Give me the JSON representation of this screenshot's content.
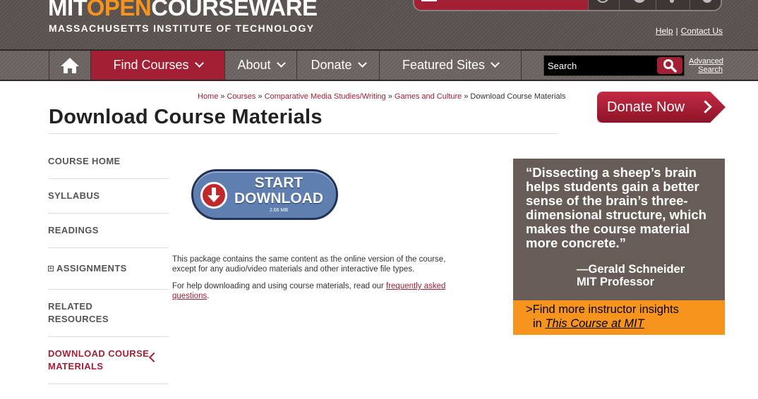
{
  "brand": {
    "logo_mit": "MIT",
    "logo_open": "OPEN",
    "logo_cw": "COURSEWARE",
    "logo_sub": "MASSACHUSETTS INSTITUTE OF TECHNOLOGY"
  },
  "util_links": {
    "help": "Help",
    "pipe": "|",
    "contact": "Contact Us"
  },
  "nav": {
    "home_icon": "home-icon",
    "find_courses": "Find Courses",
    "about": "About",
    "donate": "Donate",
    "featured_sites": "Featured Sites",
    "search_placeholder": "Search",
    "advanced_search": "Advanced\nSearch"
  },
  "breadcrumb": {
    "items": [
      "Home",
      "Courses",
      "Comparative Media Studies/Writing",
      "Games and Culture"
    ],
    "current": "Download Course Materials",
    "separator": "»"
  },
  "page_title": "Download Course Materials",
  "donate_now": "Donate Now",
  "sidebar": {
    "items": [
      {
        "label": "COURSE HOME"
      },
      {
        "label": "SYLLABUS"
      },
      {
        "label": "READINGS"
      },
      {
        "label": "ASSIGNMENTS",
        "prefix": "+"
      },
      {
        "label": "RELATED\nRESOURCES"
      },
      {
        "label": "DOWNLOAD COURSE\nMATERIALS"
      }
    ]
  },
  "download": {
    "label": "START\nDOWNLOAD",
    "size": "2.66 MB"
  },
  "description": {
    "p1": "This package contains the same content as the online version of the course, except for any audio/video materials and other interactive file types.",
    "p2_prefix": "For help downloading and using course materials, read our ",
    "p2_link": "frequently asked questions",
    "p2_suffix": "."
  },
  "quote": {
    "text": "“Dissecting a sheep’s brain helps students gain a better sense of the brain’s three-dimensional structure, which makes the course material more concrete.”",
    "author": "—Gerald Schneider\nMIT Professor"
  },
  "insight": {
    "line1": ">Find more instructor insights",
    "in": "in ",
    "link": "This Course at MIT"
  },
  "colors": {
    "brand_red": "#a31f34",
    "accent_orange": "#f7941e",
    "header_gray": "#5b534f"
  }
}
